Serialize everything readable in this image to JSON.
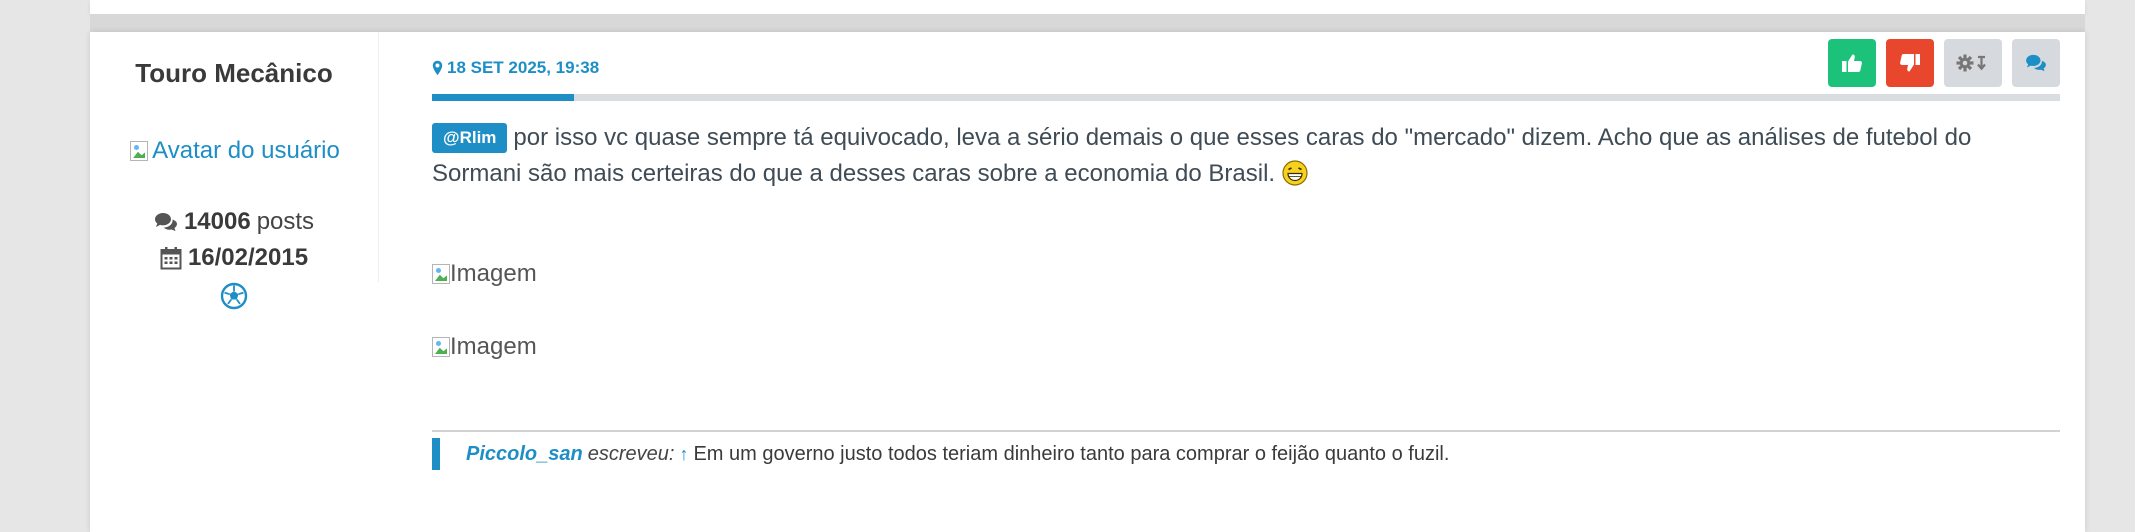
{
  "profile": {
    "username": "Touro Mecânico",
    "avatar_alt": "Avatar do usuário",
    "posts_count": "14006",
    "posts_label": "posts",
    "join_date": "16/02/2015",
    "badge_icon": "soccer-ball-icon"
  },
  "post": {
    "date": "18 SET 2025, 19:38",
    "read_progress_fraction": 0.087,
    "actions": {
      "like_icon": "thumbs-up-icon",
      "dislike_icon": "thumbs-down-icon",
      "moderate_icon": "gear-dropdown-icon",
      "quote_icon": "comments-icon"
    },
    "mention": "@Rlim",
    "text": "por isso vc quase sempre tá equivocado, leva a sério demais o que esses caras do \"mercado\" dizem. Acho que as análises de futebol do Sormani são mais certeiras do que a desses caras sobre a economia do Brasil.",
    "emoji": "laughing-emoji",
    "image_alts": [
      "Imagem",
      "Imagem"
    ],
    "quote": {
      "author": "Piccolo_san",
      "wrote": "escreveu:",
      "text": "Em um governo justo todos teriam dinheiro tanto para comprar o feijão quanto o fuzil."
    }
  },
  "colors": {
    "accent": "#1e8ec6",
    "like": "#1dc27a",
    "dislike": "#e8472d",
    "neutral_button": "#d6d9dd"
  }
}
